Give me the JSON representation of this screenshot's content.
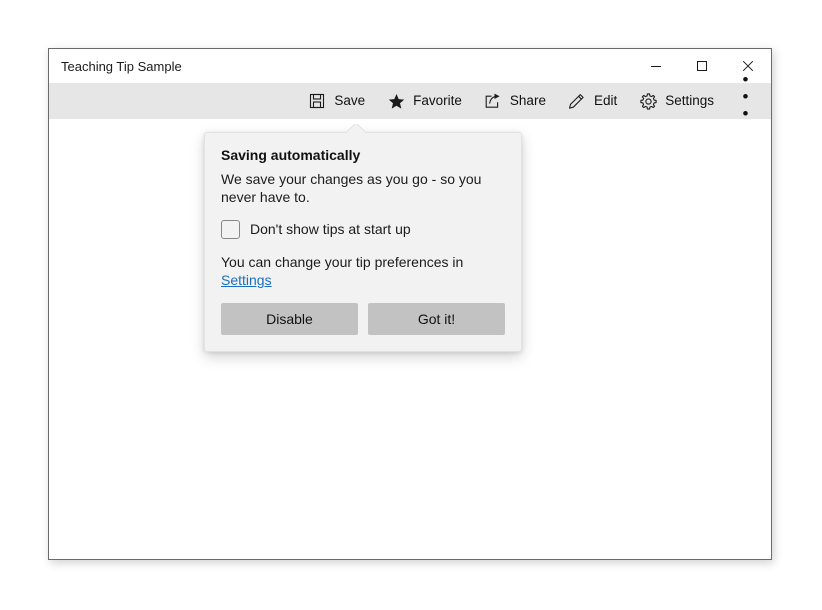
{
  "window": {
    "title": "Teaching Tip Sample",
    "caption_buttons": [
      {
        "name": "minimize",
        "icon": "minimize-icon"
      },
      {
        "name": "maximize",
        "icon": "maximize-icon"
      },
      {
        "name": "close",
        "icon": "close-icon"
      }
    ]
  },
  "commandbar": {
    "items": [
      {
        "label": "Save",
        "icon": "save-icon"
      },
      {
        "label": "Favorite",
        "icon": "star-icon"
      },
      {
        "label": "Share",
        "icon": "share-icon"
      },
      {
        "label": "Edit",
        "icon": "pencil-icon"
      },
      {
        "label": "Settings",
        "icon": "gear-icon"
      }
    ],
    "overflow_label": "• • •",
    "overflow_icon": "more-ellipsis-icon"
  },
  "teaching_tip": {
    "title": "Saving automatically",
    "subtitle": "We save your changes as you go - so you never have to.",
    "checkbox": {
      "label": "Don't show tips at start up",
      "checked": false
    },
    "footer_text_prefix": "You can change your tip preferences in ",
    "footer_link": "Settings",
    "buttons": {
      "close_label": "Disable",
      "action_label": "Got it!"
    }
  },
  "colors": {
    "window_background": "#ffffff",
    "commandbar_background": "#e6e6e6",
    "tip_background": "#f2f2f2",
    "tip_border": "#e2e2e2",
    "button_fill": "#c2c2c2",
    "link_accent": "#1a6fc4",
    "text_primary": "#1b1b1b",
    "window_border": "#6b6b6b"
  }
}
